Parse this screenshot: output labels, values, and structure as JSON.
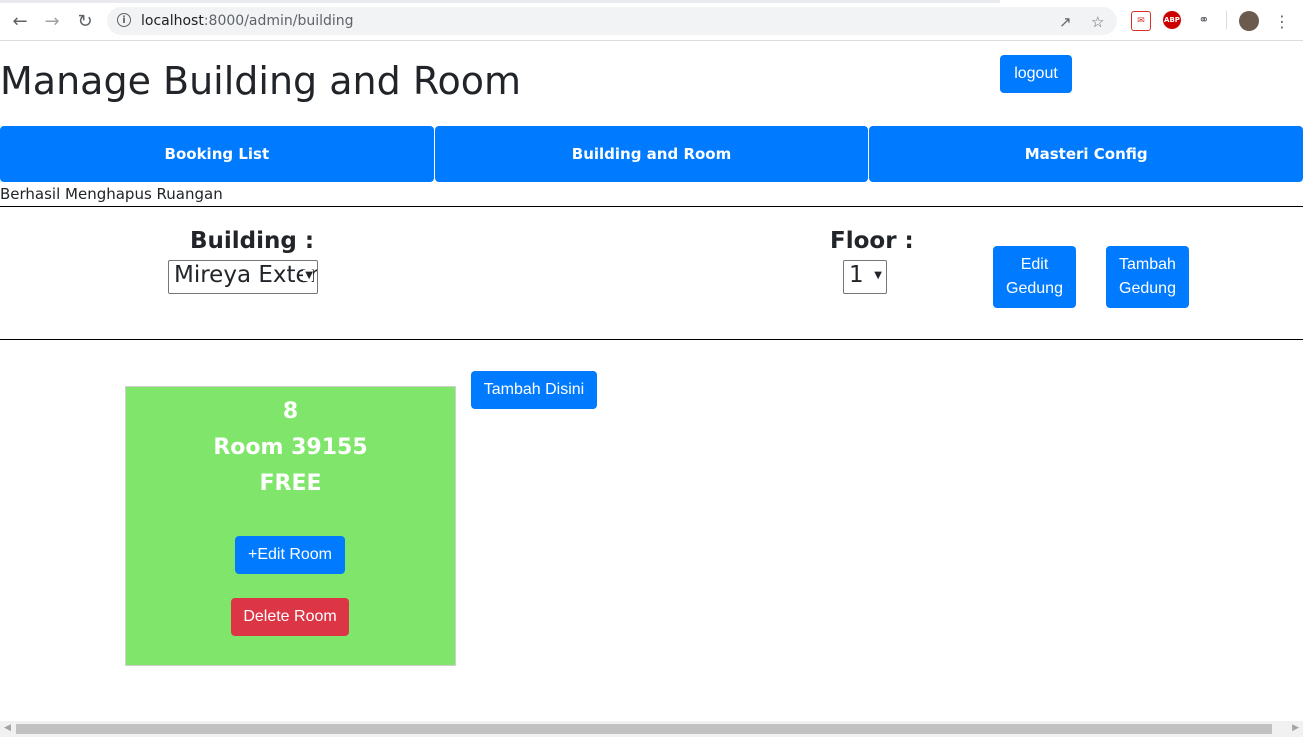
{
  "browser": {
    "url_host": "localhost",
    "url_rest": ":8000/admin/building"
  },
  "header": {
    "title": "Manage Building and Room",
    "logout_label": "logout"
  },
  "menu": {
    "items": [
      {
        "label": "Booking List"
      },
      {
        "label": "Building and Room"
      },
      {
        "label": "Masteri Config"
      }
    ]
  },
  "flash_message": "Berhasil Menghapus Ruangan",
  "filters": {
    "building_label": "Building :",
    "building_value": "Mireya Exter",
    "floor_label": "Floor :",
    "floor_value": "1",
    "edit_building_label": "Edit Gedung",
    "add_building_label": "Tambah Gedung"
  },
  "room": {
    "number": "8",
    "name": "Room 39155",
    "status": "FREE",
    "edit_label": "+Edit Room",
    "delete_label": "Delete Room"
  },
  "add_here_label": "Tambah Disini",
  "colors": {
    "primary": "#007bff",
    "danger": "#dc3545",
    "room_free": "#7fe66b"
  }
}
